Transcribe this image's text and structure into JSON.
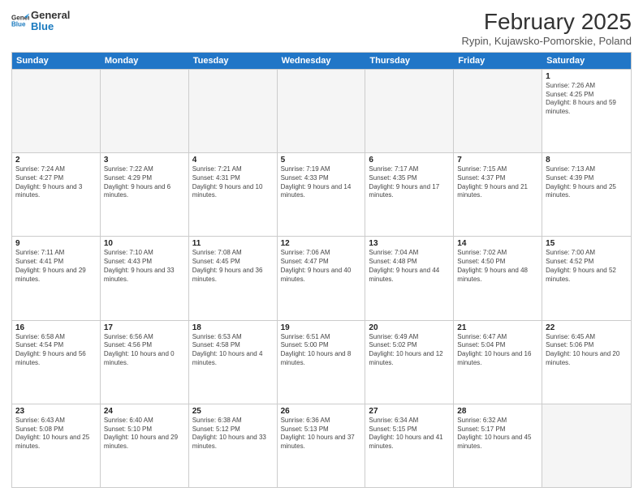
{
  "logo": {
    "line1": "General",
    "line2": "Blue"
  },
  "title": "February 2025",
  "subtitle": "Rypin, Kujawsko-Pomorskie, Poland",
  "days": [
    "Sunday",
    "Monday",
    "Tuesday",
    "Wednesday",
    "Thursday",
    "Friday",
    "Saturday"
  ],
  "weeks": [
    [
      {
        "day": "",
        "info": ""
      },
      {
        "day": "",
        "info": ""
      },
      {
        "day": "",
        "info": ""
      },
      {
        "day": "",
        "info": ""
      },
      {
        "day": "",
        "info": ""
      },
      {
        "day": "",
        "info": ""
      },
      {
        "day": "1",
        "info": "Sunrise: 7:26 AM\nSunset: 4:25 PM\nDaylight: 8 hours and 59 minutes."
      }
    ],
    [
      {
        "day": "2",
        "info": "Sunrise: 7:24 AM\nSunset: 4:27 PM\nDaylight: 9 hours and 3 minutes."
      },
      {
        "day": "3",
        "info": "Sunrise: 7:22 AM\nSunset: 4:29 PM\nDaylight: 9 hours and 6 minutes."
      },
      {
        "day": "4",
        "info": "Sunrise: 7:21 AM\nSunset: 4:31 PM\nDaylight: 9 hours and 10 minutes."
      },
      {
        "day": "5",
        "info": "Sunrise: 7:19 AM\nSunset: 4:33 PM\nDaylight: 9 hours and 14 minutes."
      },
      {
        "day": "6",
        "info": "Sunrise: 7:17 AM\nSunset: 4:35 PM\nDaylight: 9 hours and 17 minutes."
      },
      {
        "day": "7",
        "info": "Sunrise: 7:15 AM\nSunset: 4:37 PM\nDaylight: 9 hours and 21 minutes."
      },
      {
        "day": "8",
        "info": "Sunrise: 7:13 AM\nSunset: 4:39 PM\nDaylight: 9 hours and 25 minutes."
      }
    ],
    [
      {
        "day": "9",
        "info": "Sunrise: 7:11 AM\nSunset: 4:41 PM\nDaylight: 9 hours and 29 minutes."
      },
      {
        "day": "10",
        "info": "Sunrise: 7:10 AM\nSunset: 4:43 PM\nDaylight: 9 hours and 33 minutes."
      },
      {
        "day": "11",
        "info": "Sunrise: 7:08 AM\nSunset: 4:45 PM\nDaylight: 9 hours and 36 minutes."
      },
      {
        "day": "12",
        "info": "Sunrise: 7:06 AM\nSunset: 4:47 PM\nDaylight: 9 hours and 40 minutes."
      },
      {
        "day": "13",
        "info": "Sunrise: 7:04 AM\nSunset: 4:48 PM\nDaylight: 9 hours and 44 minutes."
      },
      {
        "day": "14",
        "info": "Sunrise: 7:02 AM\nSunset: 4:50 PM\nDaylight: 9 hours and 48 minutes."
      },
      {
        "day": "15",
        "info": "Sunrise: 7:00 AM\nSunset: 4:52 PM\nDaylight: 9 hours and 52 minutes."
      }
    ],
    [
      {
        "day": "16",
        "info": "Sunrise: 6:58 AM\nSunset: 4:54 PM\nDaylight: 9 hours and 56 minutes."
      },
      {
        "day": "17",
        "info": "Sunrise: 6:56 AM\nSunset: 4:56 PM\nDaylight: 10 hours and 0 minutes."
      },
      {
        "day": "18",
        "info": "Sunrise: 6:53 AM\nSunset: 4:58 PM\nDaylight: 10 hours and 4 minutes."
      },
      {
        "day": "19",
        "info": "Sunrise: 6:51 AM\nSunset: 5:00 PM\nDaylight: 10 hours and 8 minutes."
      },
      {
        "day": "20",
        "info": "Sunrise: 6:49 AM\nSunset: 5:02 PM\nDaylight: 10 hours and 12 minutes."
      },
      {
        "day": "21",
        "info": "Sunrise: 6:47 AM\nSunset: 5:04 PM\nDaylight: 10 hours and 16 minutes."
      },
      {
        "day": "22",
        "info": "Sunrise: 6:45 AM\nSunset: 5:06 PM\nDaylight: 10 hours and 20 minutes."
      }
    ],
    [
      {
        "day": "23",
        "info": "Sunrise: 6:43 AM\nSunset: 5:08 PM\nDaylight: 10 hours and 25 minutes."
      },
      {
        "day": "24",
        "info": "Sunrise: 6:40 AM\nSunset: 5:10 PM\nDaylight: 10 hours and 29 minutes."
      },
      {
        "day": "25",
        "info": "Sunrise: 6:38 AM\nSunset: 5:12 PM\nDaylight: 10 hours and 33 minutes."
      },
      {
        "day": "26",
        "info": "Sunrise: 6:36 AM\nSunset: 5:13 PM\nDaylight: 10 hours and 37 minutes."
      },
      {
        "day": "27",
        "info": "Sunrise: 6:34 AM\nSunset: 5:15 PM\nDaylight: 10 hours and 41 minutes."
      },
      {
        "day": "28",
        "info": "Sunrise: 6:32 AM\nSunset: 5:17 PM\nDaylight: 10 hours and 45 minutes."
      },
      {
        "day": "",
        "info": ""
      }
    ]
  ]
}
